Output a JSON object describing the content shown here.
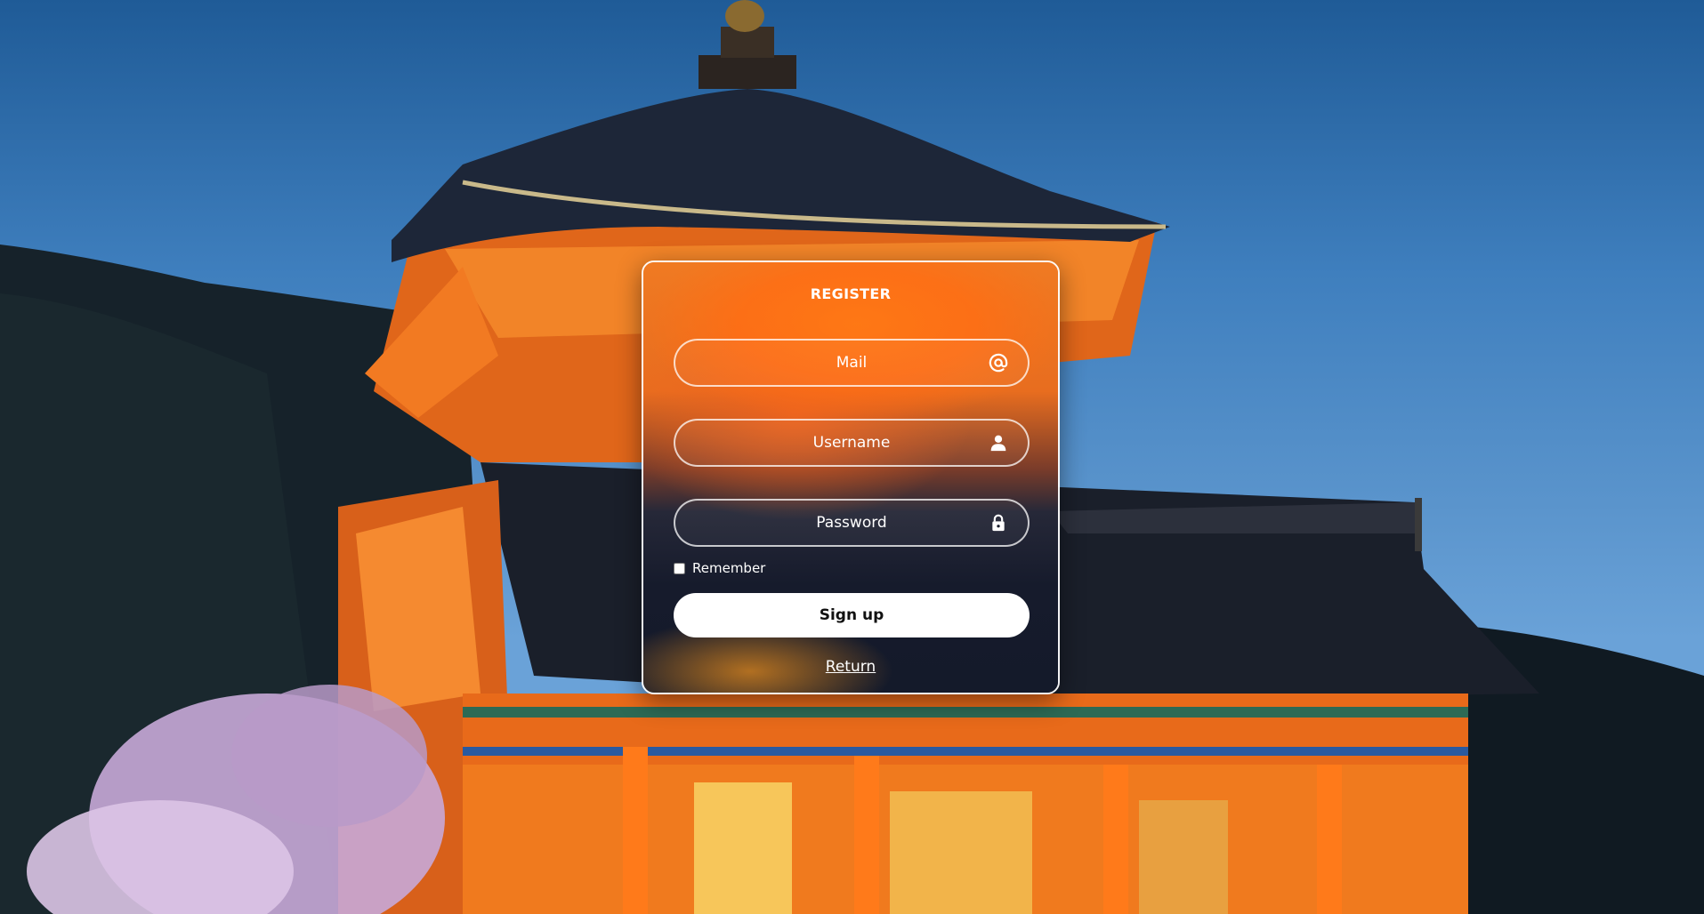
{
  "form": {
    "title": "REGISTER",
    "mail_placeholder": "Mail",
    "username_placeholder": "Username",
    "password_placeholder": "Password",
    "remember_label": "Remember",
    "remember_checked": false,
    "signup_label": "Sign up",
    "return_label": "Return"
  },
  "icons": {
    "mail": "at-icon",
    "username": "user-icon",
    "password": "lock-icon"
  },
  "colors": {
    "accent_orange": "#f07a22",
    "card_dark": "#161b2c",
    "button_bg": "#ffffff",
    "text": "#ffffff"
  }
}
